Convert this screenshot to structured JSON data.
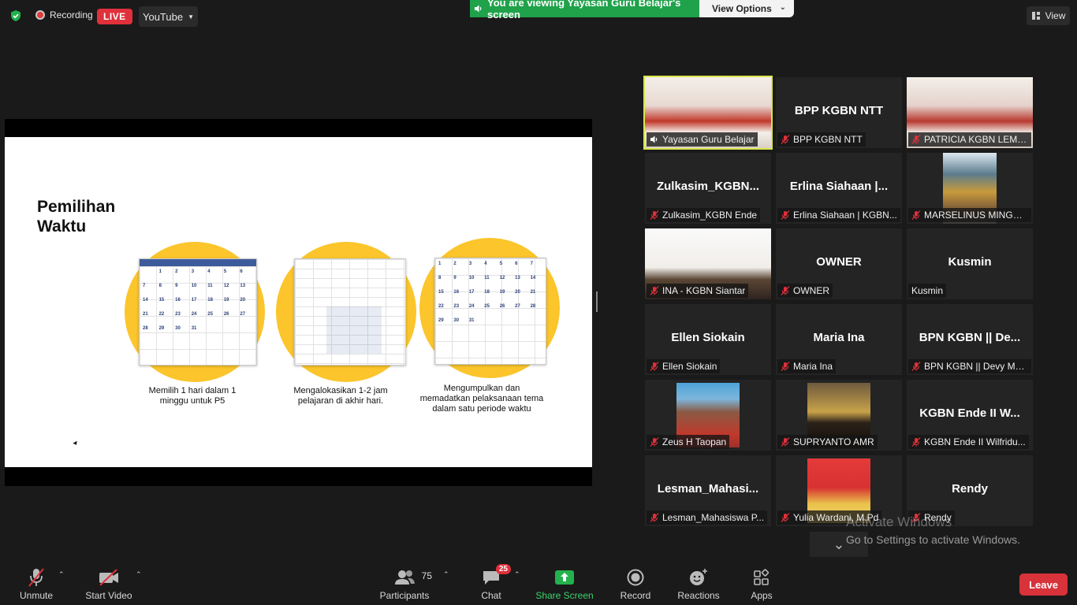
{
  "topbar": {
    "recording_label": "Recording",
    "live_label": "LIVE",
    "stream_target": "YouTube",
    "viewing_banner": "You are viewing Yayasan Guru Belajar's screen",
    "view_options_label": "View Options",
    "view_label": "View"
  },
  "slide": {
    "title": "Pemilihan Waktu",
    "captions": [
      "Memilih 1 hari dalam 1 minggu untuk P5",
      "Mengalokasikan 1-2 jam pelajaran di akhir hari.",
      "Mengumpulkan dan memadatkan pelaksanaan tema dalam satu periode waktu"
    ],
    "calendar_days": [
      "1",
      "2",
      "3",
      "4",
      "5",
      "6",
      "7",
      "8",
      "9",
      "10",
      "11",
      "12",
      "13",
      "14",
      "15",
      "16",
      "17",
      "18",
      "19",
      "20",
      "21",
      "22",
      "23",
      "24",
      "25",
      "26",
      "27",
      "28",
      "29",
      "30",
      "31"
    ]
  },
  "participants": [
    {
      "big": "",
      "label": "Yayasan Guru Belajar",
      "muted": false,
      "active": true
    },
    {
      "big": "BPP KGBN NTT",
      "label": "BPP KGBN NTT",
      "muted": true
    },
    {
      "big": "",
      "label": "PATRICIA KGBN LEMB...",
      "muted": true
    },
    {
      "big": "Zulkasim_KGBN...",
      "label": "Zulkasim_KGBN Ende",
      "muted": true
    },
    {
      "big": "Erlina Siahaan |...",
      "label": "Erlina Siahaan | KGBN...",
      "muted": true
    },
    {
      "big": "",
      "label": "MARSELINUS MINGG...",
      "muted": true
    },
    {
      "big": "",
      "label": "INA - KGBN Siantar",
      "muted": true
    },
    {
      "big": "OWNER",
      "label": "OWNER",
      "muted": true
    },
    {
      "big": "Kusmin",
      "label": "Kusmin",
      "muted": false
    },
    {
      "big": "Ellen Siokain",
      "label": "Ellen Siokain",
      "muted": true
    },
    {
      "big": "Maria Ina",
      "label": "Maria Ina",
      "muted": true
    },
    {
      "big": "BPN KGBN || De...",
      "label": "BPN KGBN || Devy Ma...",
      "muted": true
    },
    {
      "big": "",
      "label": "Zeus H Taopan",
      "muted": true
    },
    {
      "big": "",
      "label": "SUPRYANTO AMR",
      "muted": true
    },
    {
      "big": "KGBN Ende II W...",
      "label": "KGBN Ende II Wilfridu...",
      "muted": true
    },
    {
      "big": "Lesman_Mahasi...",
      "label": "Lesman_Mahasiswa P...",
      "muted": true
    },
    {
      "big": "",
      "label": "Yulia Wardani, M.Pd",
      "muted": true
    },
    {
      "big": "Rendy",
      "label": "Rendy",
      "muted": true
    }
  ],
  "watermark": {
    "line1": "Activate Windows",
    "line2": "Go to Settings to activate Windows."
  },
  "toolbar": {
    "unmute": "Unmute",
    "start_video": "Start Video",
    "participants": "Participants",
    "participants_count": "75",
    "chat": "Chat",
    "chat_badge": "25",
    "share_screen": "Share Screen",
    "record": "Record",
    "reactions": "Reactions",
    "apps": "Apps",
    "leave": "Leave"
  },
  "colors": {
    "share_green": "#1fa24a",
    "live_red": "#e0303b",
    "active_speaker": "#d8e64a",
    "slide_circle": "#fbc52b"
  }
}
